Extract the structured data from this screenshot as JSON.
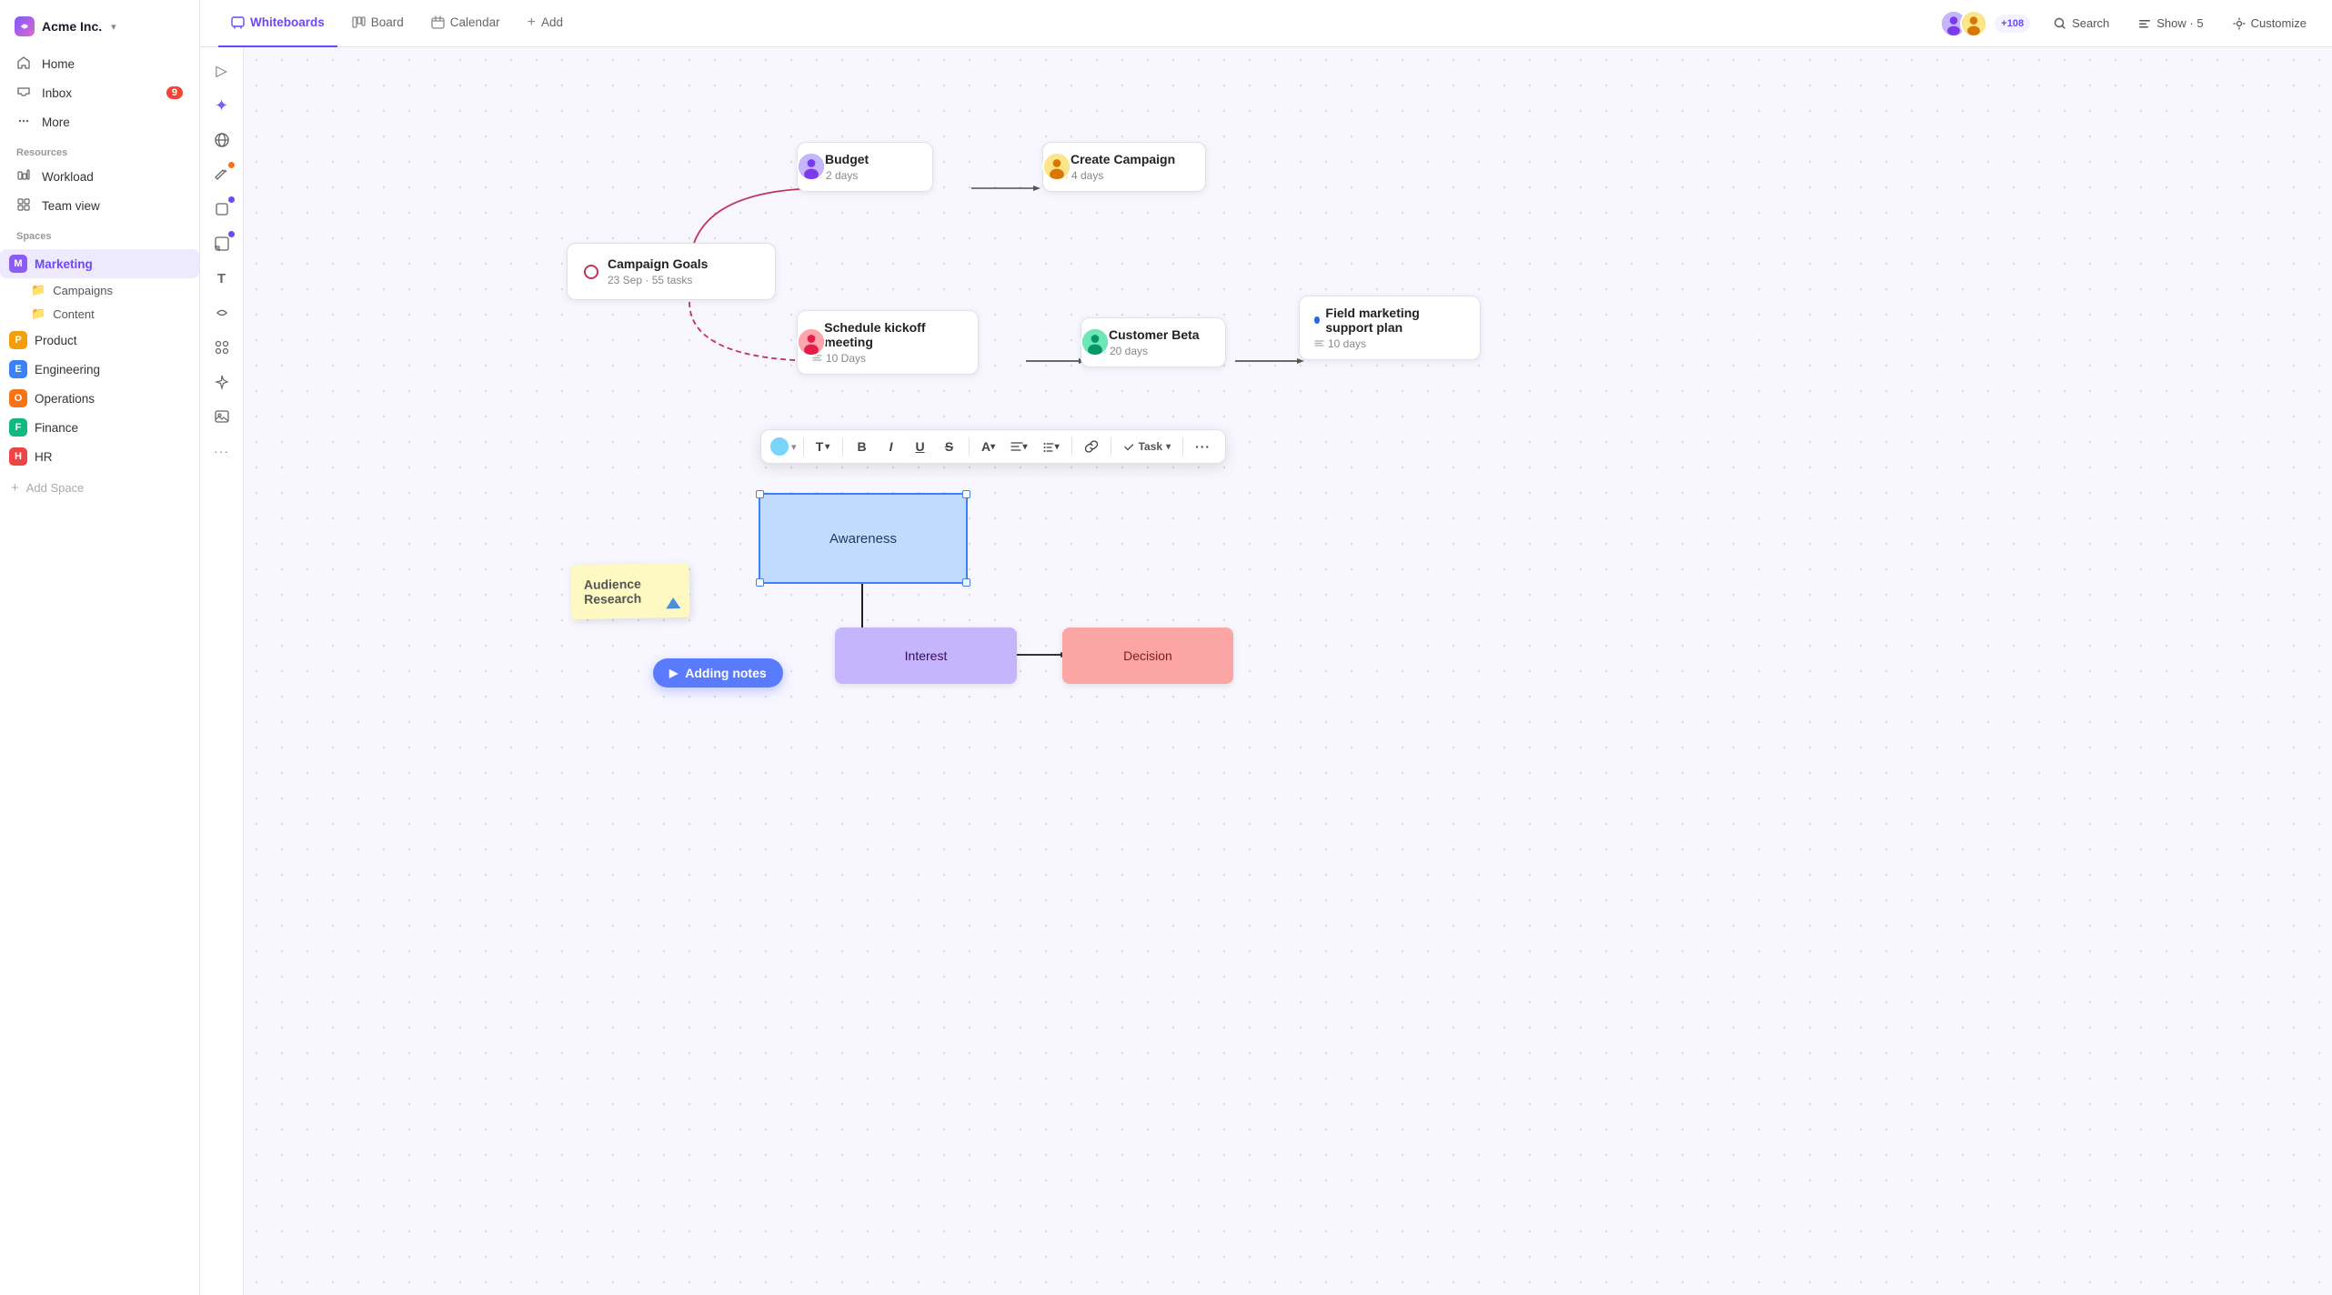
{
  "app": {
    "name": "Acme Inc.",
    "logo_color_start": "#7c5cfc",
    "logo_color_end": "#e066d0"
  },
  "nav": {
    "home": "Home",
    "inbox": "Inbox",
    "inbox_badge": "9",
    "more": "More"
  },
  "resources": {
    "title": "Resources",
    "workload": "Workload",
    "team_view": "Team view"
  },
  "spaces": {
    "title": "Spaces",
    "items": [
      {
        "id": "marketing",
        "label": "Marketing",
        "color": "#8b5cf6",
        "letter": "M",
        "active": true
      },
      {
        "id": "product",
        "label": "Product",
        "color": "#f59e0b",
        "letter": "P",
        "active": false
      },
      {
        "id": "engineering",
        "label": "Engineering",
        "color": "#3b82f6",
        "letter": "E",
        "active": false
      },
      {
        "id": "operations",
        "label": "Operations",
        "color": "#f97316",
        "letter": "O",
        "active": false
      },
      {
        "id": "finance",
        "label": "Finance",
        "color": "#10b981",
        "letter": "F",
        "active": false
      },
      {
        "id": "hr",
        "label": "HR",
        "color": "#ef4444",
        "letter": "H",
        "active": false
      }
    ],
    "sub_items": [
      "Campaigns",
      "Content"
    ],
    "add_space": "Add Space"
  },
  "topbar": {
    "tabs": [
      {
        "id": "whiteboards",
        "label": "Whiteboards",
        "active": true,
        "icon": "whiteboard"
      },
      {
        "id": "board",
        "label": "Board",
        "active": false,
        "icon": "board"
      },
      {
        "id": "calendar",
        "label": "Calendar",
        "active": false,
        "icon": "calendar"
      },
      {
        "id": "add",
        "label": "Add",
        "active": false,
        "icon": "plus"
      }
    ],
    "search": "Search",
    "show": "Show · 5",
    "customize": "Customize",
    "avatar_count": "+108"
  },
  "tools": [
    {
      "id": "cursor",
      "icon": "▷",
      "dot_color": null
    },
    {
      "id": "ai",
      "icon": "✦",
      "dot_color": null
    },
    {
      "id": "globe",
      "icon": "◎",
      "dot_color": null
    },
    {
      "id": "pen",
      "icon": "✏",
      "dot_color": "#f97316"
    },
    {
      "id": "rect",
      "icon": "□",
      "dot_color": "#6c47ff"
    },
    {
      "id": "sticky",
      "icon": "⬛",
      "dot_color": "#6c47ff"
    },
    {
      "id": "text",
      "icon": "T",
      "dot_color": null
    },
    {
      "id": "connect",
      "icon": "⚡",
      "dot_color": null
    },
    {
      "id": "group",
      "icon": "⊞",
      "dot_color": null
    },
    {
      "id": "ai2",
      "icon": "✶",
      "dot_color": null
    },
    {
      "id": "image",
      "icon": "🖼",
      "dot_color": null
    },
    {
      "id": "more",
      "icon": "···",
      "dot_color": null
    }
  ],
  "canvas": {
    "nodes": {
      "campaign_goals": {
        "title": "Campaign Goals",
        "meta": "23 Sep · 55 tasks"
      },
      "budget": {
        "title": "Budget",
        "meta": "2 days",
        "dot_color": "#16a34a"
      },
      "create_campaign": {
        "title": "Create Campaign",
        "meta": "4 days",
        "dot_color": "#16a34a"
      },
      "schedule_kickoff": {
        "title": "Schedule kickoff meeting",
        "meta": "10 Days",
        "dot_color": "#16a34a"
      },
      "customer_beta": {
        "title": "Customer Beta",
        "meta": "20 days",
        "dot_color": "#16a34a"
      },
      "field_marketing": {
        "title": "Field marketing support plan",
        "meta": "10 days",
        "dot_color": "#2563eb"
      }
    },
    "flowchart": {
      "awareness": "Awareness",
      "interest": "Interest",
      "decision": "Decision",
      "audience_research": "Audience\nResearch"
    },
    "tooltip": "Adding notes"
  },
  "format_toolbar": {
    "color_circle": "#7ad4f8",
    "buttons": [
      "T▼",
      "B",
      "I",
      "U",
      "S",
      "A▼",
      "≡▼",
      "≡▼",
      "🔗",
      "↻ Task▼",
      "···"
    ]
  }
}
